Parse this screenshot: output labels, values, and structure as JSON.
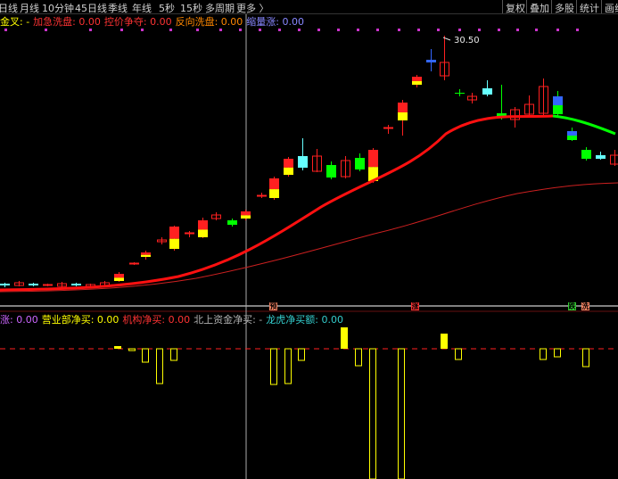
{
  "toolbar": {
    "left_items": [
      "日线",
      "月线",
      "10分钟",
      "45日线",
      "季线",
      "年线",
      "5秒",
      "15秒",
      "多周期",
      "更多 〉"
    ],
    "right_items": [
      "复权",
      "叠加",
      "多股",
      "统计",
      "画线"
    ]
  },
  "main_legend": {
    "items": [
      {
        "label": "金叉: -",
        "color": "#ffff00"
      },
      {
        "label": "加急洗盘: 0.00",
        "color": "#ff3333"
      },
      {
        "label": "控价争夺: 0.00",
        "color": "#ff3333"
      },
      {
        "label": "反向洗盘: 0.00",
        "color": "#ff8800"
      },
      {
        "label": "缩量涨: 0.00",
        "color": "#8888ff"
      }
    ]
  },
  "sub_legend": {
    "items": [
      {
        "label": "涨: 0.00",
        "color": "#cc66ff"
      },
      {
        "label": "营业部净买: 0.00",
        "color": "#ffff00"
      },
      {
        "label": "机构净买: 0.00",
        "color": "#ff3333"
      },
      {
        "label": "北上资金净买: -",
        "color": "#b0b0b0"
      },
      {
        "label": "龙虎净买额: 0.00",
        "color": "#33cccc"
      }
    ]
  },
  "peak_label": "30.50",
  "markers": [
    {
      "text": "预",
      "color": "#ff8866"
    },
    {
      "text": "涨",
      "color": "#ff3333"
    },
    {
      "text": "跌",
      "color": "#33cc33"
    },
    {
      "text": "洗",
      "color": "#ff8866"
    }
  ],
  "colors": {
    "up": "#ff2020",
    "down": "#00ff00",
    "cyan": "#66ffff",
    "yellow": "#ffff00",
    "ma_thick": "#ff1010",
    "ma_thin": "#cc2020",
    "ma_green": "#00ff00",
    "dot": "#cc33cc"
  }
}
